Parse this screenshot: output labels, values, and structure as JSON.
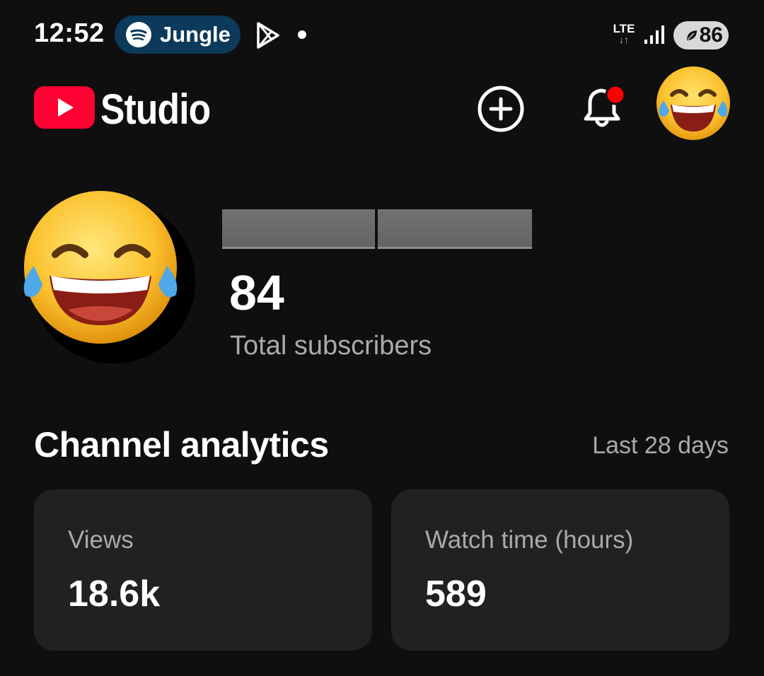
{
  "status_bar": {
    "time": "12:52",
    "media_pill": {
      "app_icon": "spotify-icon",
      "label": "Jungle",
      "color": "#0c3a5a"
    },
    "notification_icon": "play-store-icon",
    "network": "LTE",
    "signal_icon": "signal-bars-icon",
    "battery": "86",
    "battery_saver_icon": "leaf-icon"
  },
  "header": {
    "logo_icon": "youtube-logo-icon",
    "title": "Studio",
    "create_icon": "create-plus-icon",
    "notifications_icon": "bell-icon",
    "notification_badge_color": "#ff0000",
    "account_avatar": "laughing-tears-emoji"
  },
  "channel": {
    "avatar": "laughing-tears-emoji",
    "name_redacted": true,
    "subscriber_count": "84",
    "subscriber_label": "Total subscribers"
  },
  "analytics": {
    "title": "Channel analytics",
    "period": "Last 28 days",
    "cards": [
      {
        "label": "Views",
        "value": "18.6k"
      },
      {
        "label": "Watch time (hours)",
        "value": "589"
      }
    ]
  },
  "colors": {
    "background": "#0f0f0f",
    "card": "#212121",
    "brand_red": "#ff0033",
    "secondary_text": "#aaaaaa"
  }
}
